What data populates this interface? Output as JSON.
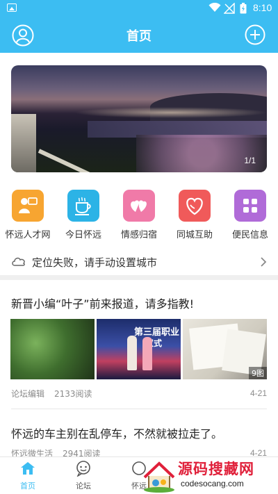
{
  "status_bar": {
    "time": "8:10"
  },
  "header": {
    "title": "首页"
  },
  "banner": {
    "pager": "1/1"
  },
  "grid": [
    {
      "label": "怀远人才网",
      "icon": "person-card-icon",
      "color": "#f7a531"
    },
    {
      "label": "今日怀远",
      "icon": "coffee-icon",
      "color": "#2cb3e6"
    },
    {
      "label": "情感归宿",
      "icon": "hearts-icon",
      "color": "#f07aa8"
    },
    {
      "label": "同城互助",
      "icon": "heart-outline-icon",
      "color": "#f05a5a"
    },
    {
      "label": "便民信息",
      "icon": "grid-icon",
      "color": "#b06bd8"
    }
  ],
  "location": {
    "text": "定位失败，请手动设置城市"
  },
  "posts": [
    {
      "title": "新晋小编“叶子”前来报道，请多指教!",
      "author": "论坛编辑",
      "reads": "2133阅读",
      "date": "4-21",
      "thumb_caption": "第三届职业",
      "thumb_caption2": "仪式",
      "image_count": "9图"
    },
    {
      "title": "怀远的车主别在乱停车，不然就被拉走了。",
      "author": "怀远微生活",
      "reads": "2941阅读",
      "date": "4-21"
    }
  ],
  "nav": [
    {
      "label": "首页",
      "icon": "home-icon",
      "active": true
    },
    {
      "label": "论坛",
      "icon": "forum-icon",
      "active": false
    },
    {
      "label": "怀远",
      "icon": "community-icon",
      "active": false
    }
  ],
  "watermark": {
    "big": "源码搜藏网",
    "small": "codesocang.com"
  },
  "colors": {
    "accent": "#3cbdf2",
    "watermark_red": "#e0203a"
  }
}
